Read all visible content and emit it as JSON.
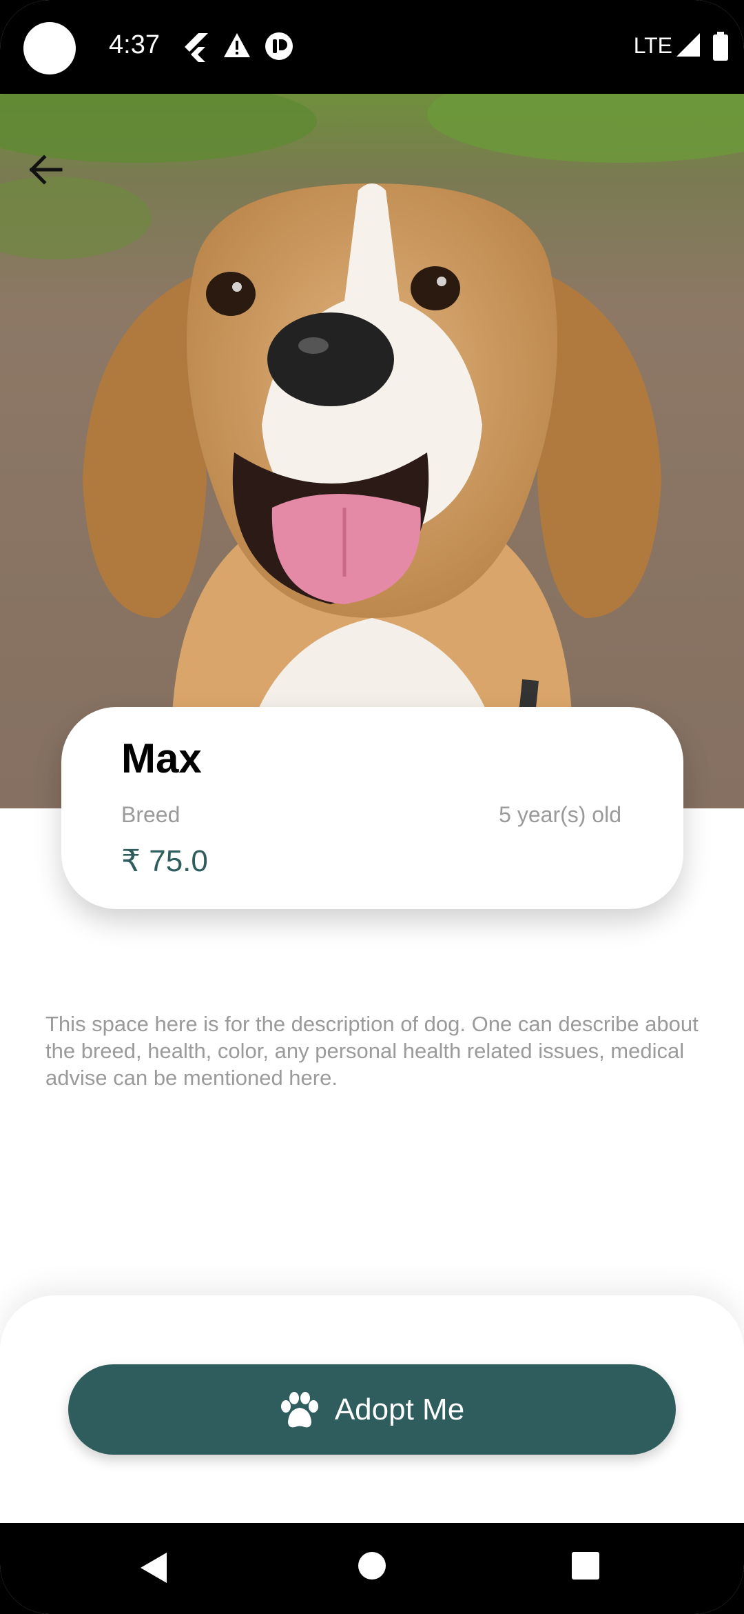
{
  "status_bar": {
    "time": "4:37",
    "network": "LTE",
    "icons": [
      "flutter-icon",
      "warning-icon",
      "app-notification-icon",
      "signal-icon",
      "battery-icon"
    ]
  },
  "hero": {
    "image": "beagle-dog-photo",
    "back_icon": "back-arrow-icon"
  },
  "pet": {
    "name": "Max",
    "breed_label": "Breed",
    "age": "5 year(s) old",
    "currency_symbol": "₹",
    "price": "75.0"
  },
  "description": "This space here is for the description of dog. One can describe about the breed, health, color, any personal health related issues, medical advise can be mentioned here.",
  "action": {
    "label": "Adopt Me",
    "icon": "paw-icon",
    "color": "#2F5D5D"
  },
  "nav": {
    "icons": [
      "nav-back-icon",
      "nav-home-icon",
      "nav-recents-icon"
    ]
  },
  "colors": {
    "accent": "#2F5D5D",
    "muted_text": "#9A9A9A"
  }
}
